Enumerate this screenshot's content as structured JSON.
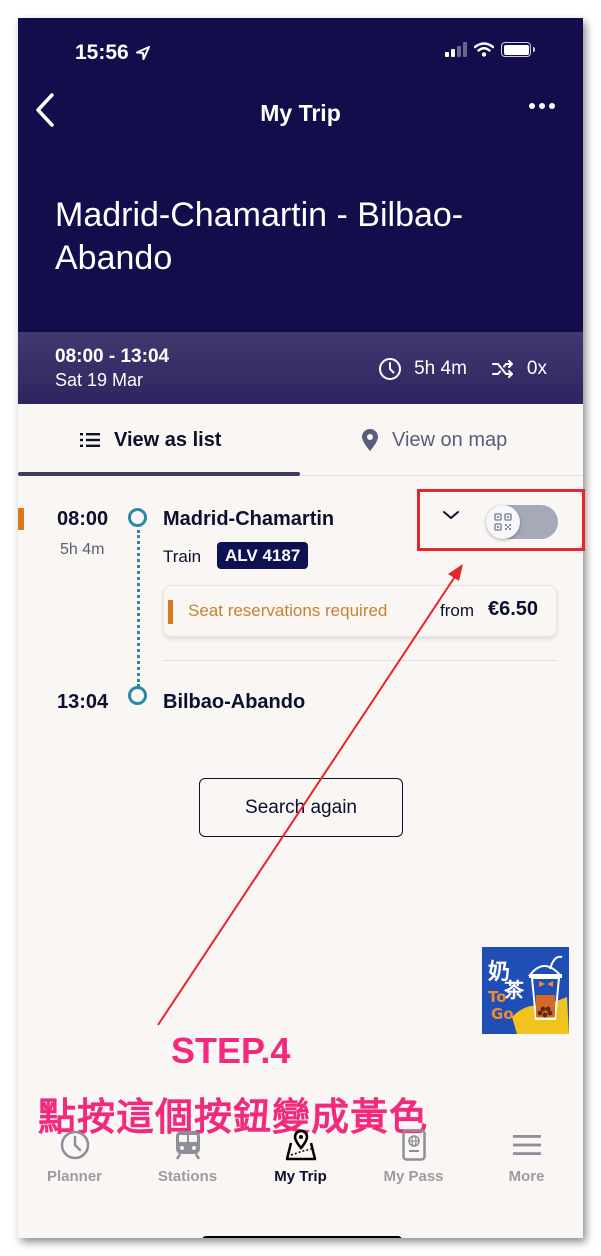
{
  "status_bar": {
    "time": "15:56",
    "location_icon": "location-arrow-icon",
    "signal_icon": "cellular-signal-icon",
    "wifi_icon": "wifi-icon",
    "battery_icon": "battery-icon"
  },
  "nav": {
    "back_icon": "chevron-left-icon",
    "title": "My Trip",
    "more_icon": "ellipsis-icon"
  },
  "route": {
    "title": "Madrid-Chamartin - Bilbao-Abando"
  },
  "summary": {
    "time_range": "08:00 - 13:04",
    "date": "Sat 19 Mar",
    "duration": "5h 4m",
    "transfers": "0x",
    "duration_icon": "clock-icon",
    "transfers_icon": "shuffle-icon"
  },
  "tabs": [
    {
      "label": "View as list",
      "icon": "list-icon",
      "active": true
    },
    {
      "label": "View on map",
      "icon": "map-pin-icon",
      "active": false
    }
  ],
  "journey": {
    "departure": {
      "time": "08:00",
      "station": "Madrid-Chamartin"
    },
    "duration": "5h 4m",
    "mode": "Train",
    "train_number": "ALV 4187",
    "expand_icon": "chevron-down-icon",
    "qr_toggle": {
      "icon": "qr-code-icon",
      "on": false
    },
    "seat_notice": {
      "text": "Seat reservations required",
      "from_label": "from",
      "price": "€6.50"
    },
    "arrival": {
      "time": "13:04",
      "station": "Bilbao-Abando"
    }
  },
  "actions": {
    "search_again": "Search again"
  },
  "annotation": {
    "step": "STEP.4",
    "instruction": "點按這個按鈕變成黃色"
  },
  "sticker": {
    "line1": "奶茶",
    "line2": "To Go"
  },
  "tabbar": [
    {
      "label": "Planner",
      "icon": "clock-icon",
      "active": false
    },
    {
      "label": "Stations",
      "icon": "train-icon",
      "active": false
    },
    {
      "label": "My Trip",
      "icon": "map-trip-icon",
      "active": true
    },
    {
      "label": "My Pass",
      "icon": "passport-icon",
      "active": false
    },
    {
      "label": "More",
      "icon": "menu-icon",
      "active": false
    }
  ],
  "colors": {
    "header_bg": "#130d4c",
    "summary_bg": "#2c2560",
    "accent_teal": "#2a8aa6",
    "warning_orange": "#d9781c",
    "badge_navy": "#0e1253",
    "annotation_red": "#e8252b",
    "annotation_pink": "#f2297c"
  }
}
